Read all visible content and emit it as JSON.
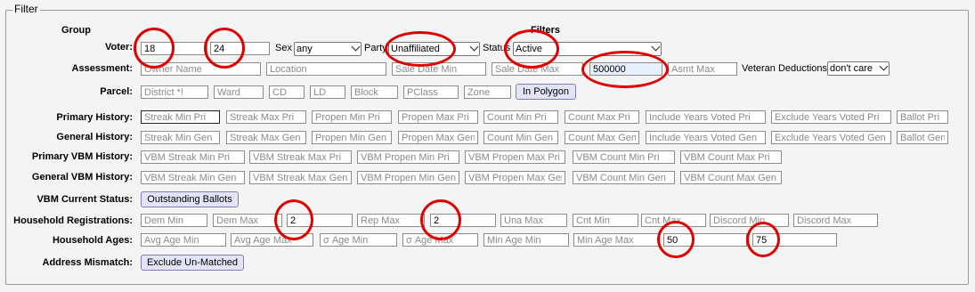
{
  "legend": "Filter",
  "headers": {
    "group": "Group",
    "filters": "Filters"
  },
  "voter": {
    "label": "Voter:",
    "age_min": "18",
    "age_max": "24",
    "sex_label": "Sex",
    "sex_value": "any",
    "party_label": "Party",
    "party_value": "Unaffiliated",
    "status_label": "Status",
    "status_value": "Active"
  },
  "assessment": {
    "label": "Assessment:",
    "owner_name": "Owner Name",
    "location": "Location",
    "sale_date_min": "Sale Date Min",
    "sale_date_max": "Sale Date Max",
    "asmt_min_value": "500000",
    "asmt_max": "Asmt Max",
    "veteran_label": "Veteran Deductions",
    "veteran_value": "don't care"
  },
  "parcel": {
    "label": "Parcel:",
    "district": "District *!",
    "ward": "Ward",
    "cd": "CD",
    "ld": "LD",
    "block": "Block",
    "pclass": "PClass",
    "zone": "Zone",
    "polygon_button": "In Polygon"
  },
  "primary_history": {
    "label": "Primary History:",
    "fields": [
      "Streak Min Pri",
      "Streak Max Pri",
      "Propen Min Pri",
      "Propen Max Pri",
      "Count Min Pri",
      "Count Max Pri",
      "Include Years Voted Pri",
      "Exclude Years Voted Pri",
      "Ballot Pri"
    ]
  },
  "general_history": {
    "label": "General History:",
    "fields": [
      "Streak Min Gen",
      "Streak Max Gen",
      "Propen Min Gen",
      "Propen Max Gen",
      "Count Min Gen",
      "Count Max Gen",
      "Include Years Voted Gen",
      "Exclude Years Voted Gen",
      "Ballot Gen"
    ]
  },
  "primary_vbm": {
    "label": "Primary VBM History:",
    "fields": [
      "VBM Streak Min Pri",
      "VBM Streak Max Pri",
      "VBM Propen Min Pri",
      "VBM Propen Max Pri",
      "VBM Count Min Pri",
      "VBM Count Max Pri"
    ]
  },
  "general_vbm": {
    "label": "General VBM History:",
    "fields": [
      "VBM Streak Min Gen",
      "VBM Streak Max Gen",
      "VBM Propen Min Gen",
      "VBM Propen Max Gen",
      "VBM Count Min Gen",
      "VBM Count Max Gen"
    ]
  },
  "vbm_status": {
    "label": "VBM Current Status:",
    "button": "Outstanding Ballots"
  },
  "household_reg": {
    "label": "Household Registrations:",
    "dem_min": "Dem Min",
    "dem_max": "Dem Max",
    "rep_min_value": "2",
    "rep_max": "Rep Max",
    "una_min_value": "2",
    "una_max": "Una Max",
    "cnt_min": "Cnt Min",
    "cnt_max": "Cnt Max",
    "discord_min": "Discord Min",
    "discord_max": "Discord Max"
  },
  "household_ages": {
    "label": "Household Ages:",
    "avg_age_min": "Avg Age Min",
    "avg_age_max": "Avg Age Max",
    "sd_age_min": "σ Age Min",
    "sd_age_max": "σ Age Max",
    "min_age_min": "Min Age Min",
    "min_age_max": "Min Age Max",
    "max_age_min_value": "50",
    "max_age_max_value": "75"
  },
  "address_mismatch": {
    "label": "Address Mismatch:",
    "button": "Exclude Un-Matched"
  },
  "colors": {
    "annotation": "#e00000",
    "button_bg": "#e4e4f7",
    "highlight_input": "#e8f0fe"
  }
}
